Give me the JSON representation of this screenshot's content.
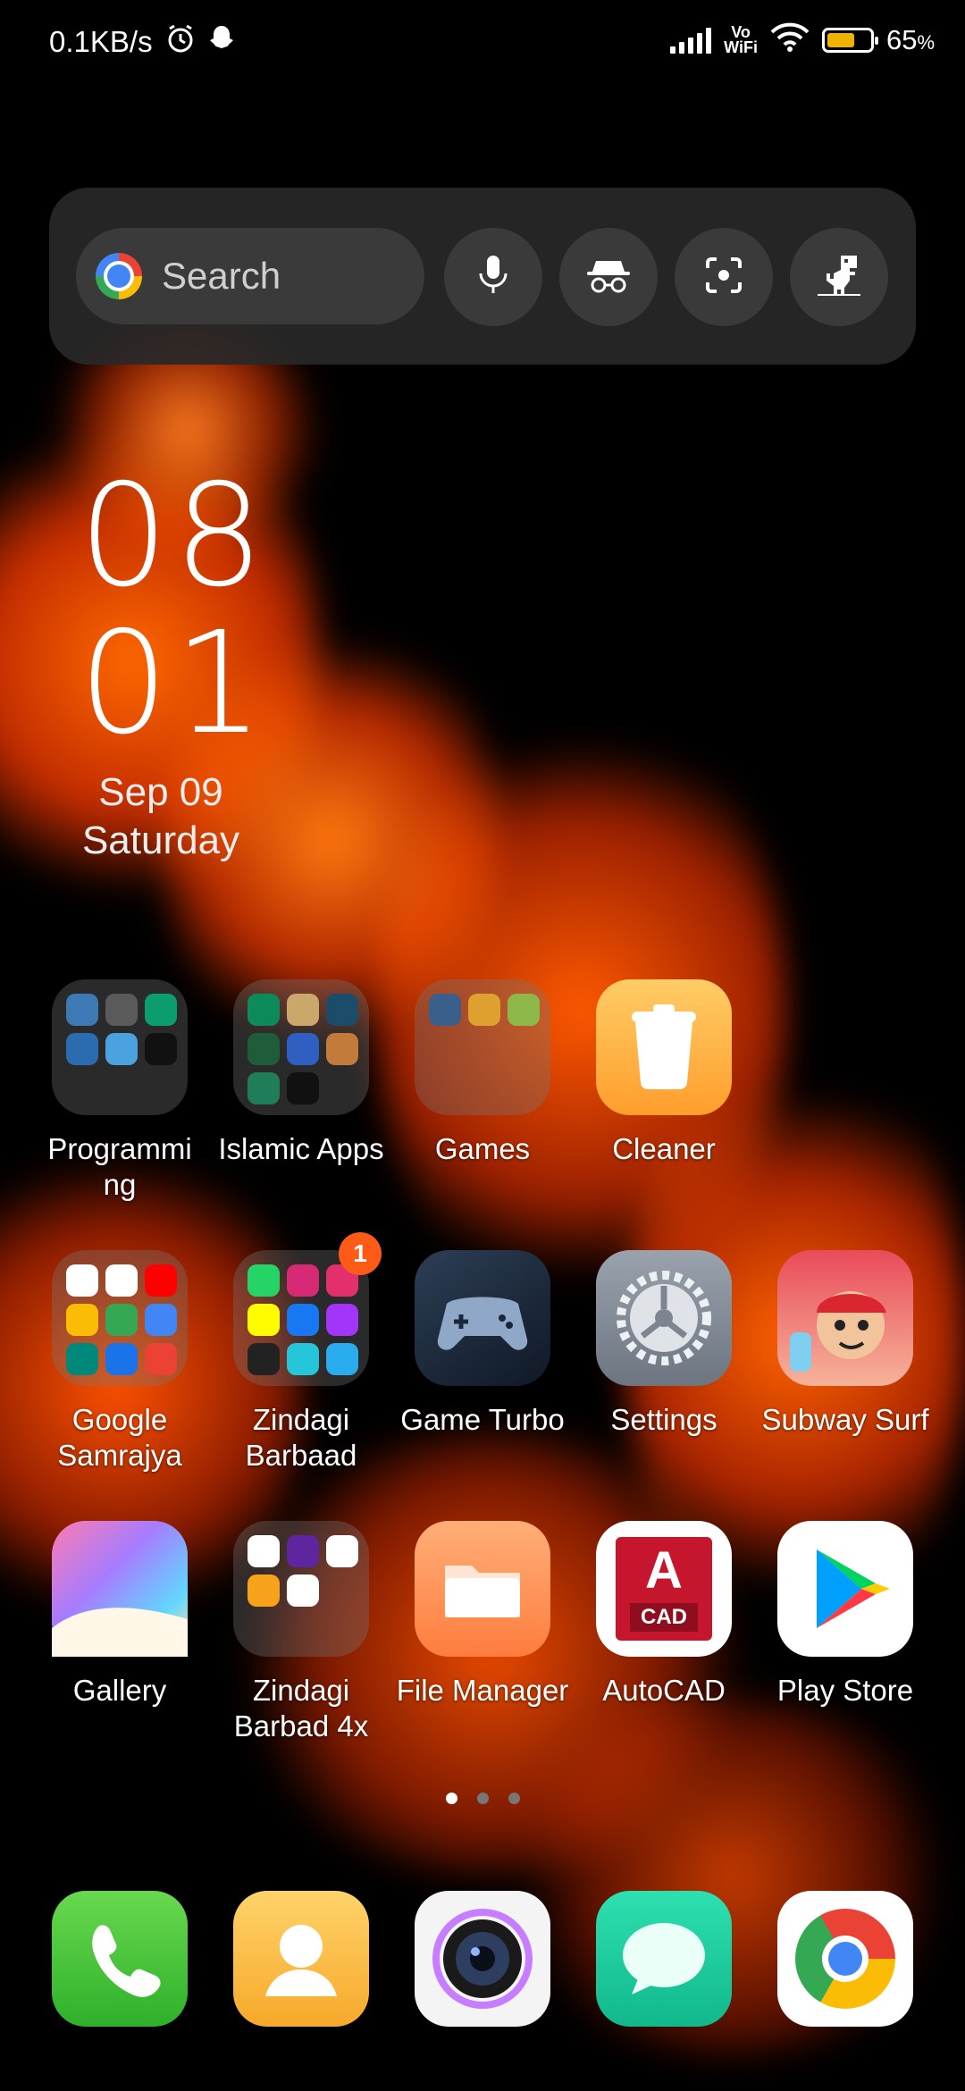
{
  "status_bar": {
    "net_speed": "0.1KB/s",
    "vowifi_top": "Vo",
    "vowifi_bottom": "WiFi",
    "battery_percent_label": "65",
    "battery_unit": "%",
    "battery_level": 0.65,
    "icons": [
      "alarm-icon",
      "snapchat-ghost-icon",
      "signal-icon",
      "wifi-icon",
      "battery-icon"
    ]
  },
  "search_widget": {
    "placeholder": "Search",
    "buttons": [
      "mic-icon",
      "incognito-icon",
      "lens-icon",
      "dino-icon"
    ]
  },
  "clock": {
    "hours": "08",
    "minutes": "01",
    "date": "Sep 09",
    "day": "Saturday"
  },
  "apps": {
    "programming": "Programmi ng",
    "islamic": "Islamic Apps",
    "games": "Games",
    "cleaner": "Cleaner",
    "google": "Google Samrajya",
    "zindagi": "Zindagi Barbaad",
    "zindagi_badge": "1",
    "game_turbo": "Game Turbo",
    "settings": "Settings",
    "subway": "Subway Surf",
    "gallery": "Gallery",
    "zindagi4x": "Zindagi Barbad 4x",
    "file_manager": "File Manager",
    "autocad": "AutoCAD",
    "autocad_icon_letter": "A",
    "autocad_icon_text": "CAD",
    "play_store": "Play Store"
  },
  "page_indicator": {
    "pages": 3,
    "active": 1
  },
  "dock": [
    "phone-icon",
    "contacts-icon",
    "camera-icon",
    "messages-icon",
    "chrome-icon"
  ],
  "colors": {
    "badge": "#ff5b17",
    "flame": "#ff5a00",
    "battery": "#f0b400"
  }
}
